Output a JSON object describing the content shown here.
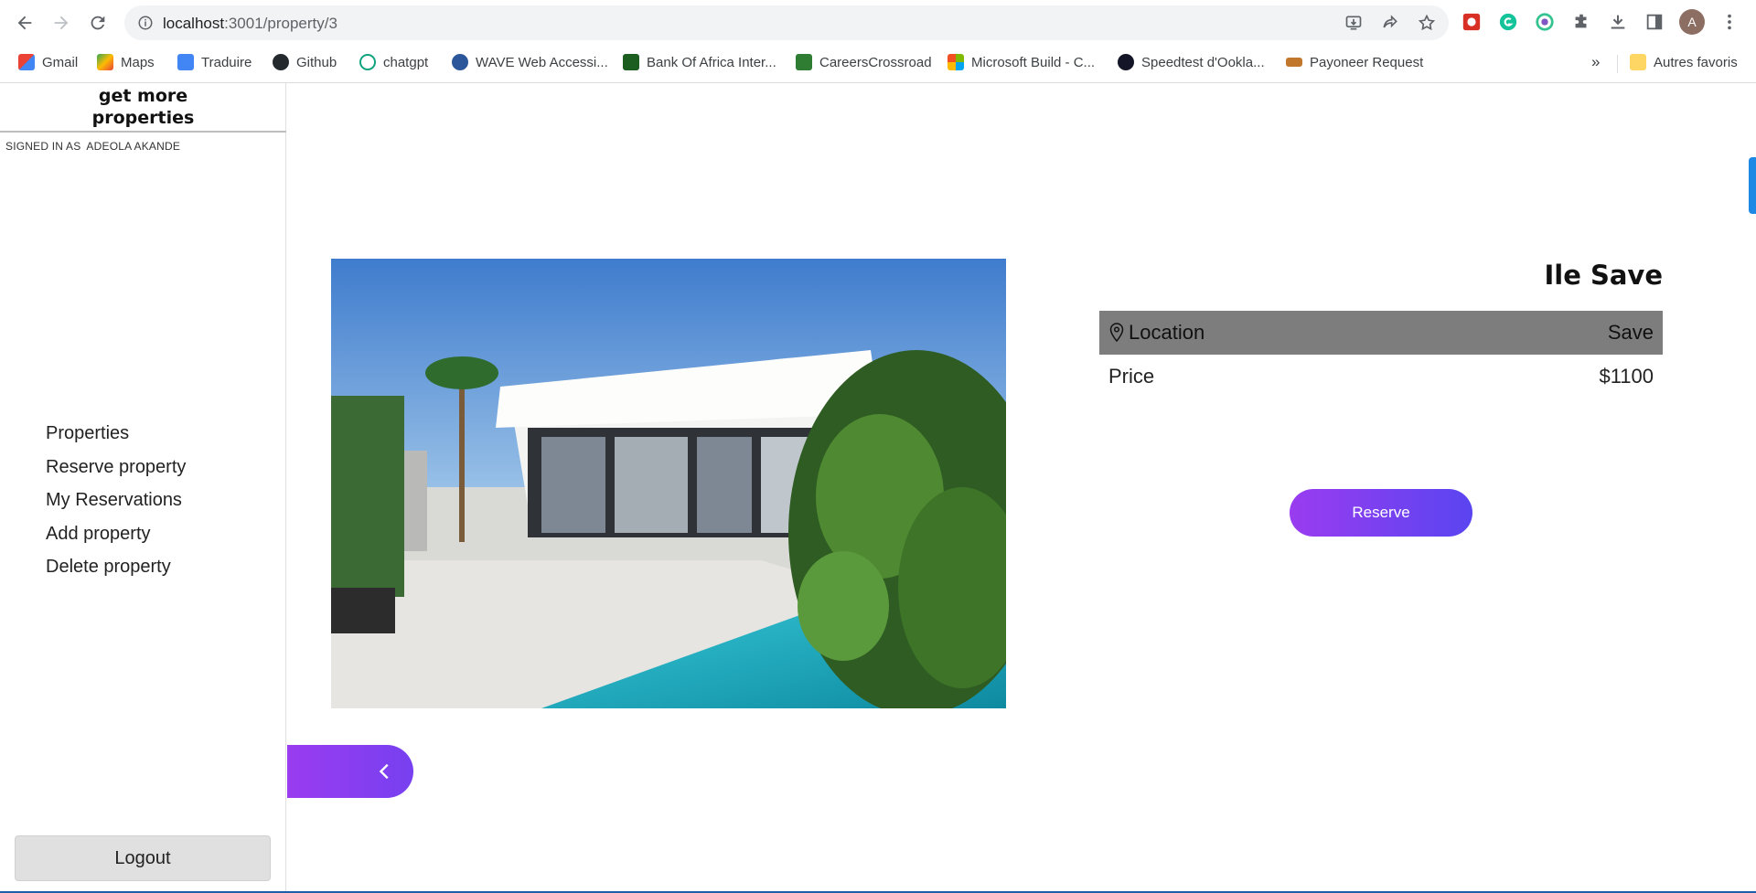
{
  "browser": {
    "url_host": "localhost",
    "url_path": ":3001/property/3",
    "bookmarks": [
      {
        "label": "Gmail",
        "color": "#ea4335"
      },
      {
        "label": "Maps",
        "color": "#34a853"
      },
      {
        "label": "Traduire",
        "color": "#4285f4"
      },
      {
        "label": "Github",
        "color": "#24292e"
      },
      {
        "label": "chatgpt",
        "color": "#10a37f"
      },
      {
        "label": "WAVE Web Accessi...",
        "color": "#2b579a"
      },
      {
        "label": "Bank Of Africa Inter...",
        "color": "#1b5e20"
      },
      {
        "label": "CareersCrossroad",
        "color": "#2e7d32"
      },
      {
        "label": "Microsoft Build - C...",
        "color": "#f25022"
      },
      {
        "label": "Speedtest d'Ookla...",
        "color": "#141526"
      },
      {
        "label": "Payoneer Request",
        "color": "#c1782c"
      },
      {
        "label": "Autres favoris",
        "color": "#fdd663"
      }
    ],
    "more_label": "»",
    "avatar_letter": "A"
  },
  "sidebar": {
    "brand_line1": "get more",
    "brand_line2": "properties",
    "signed_in_label": "SIGNED IN AS",
    "signed_in_user": "ADEOLA AKANDE",
    "menu": [
      {
        "label": "Properties"
      },
      {
        "label": "Reserve property"
      },
      {
        "label": "My Reservations"
      },
      {
        "label": "Add property"
      },
      {
        "label": "Delete property"
      }
    ],
    "logout_label": "Logout"
  },
  "property": {
    "title": "Ile Save",
    "location_label": "Location",
    "location_value": "Save",
    "price_label": "Price",
    "price_value": "$1100",
    "reserve_label": "Reserve"
  },
  "colors": {
    "accent_start": "#9a3cf0",
    "accent_end": "#5a45f0",
    "table_shade": "#7d7d7d"
  }
}
